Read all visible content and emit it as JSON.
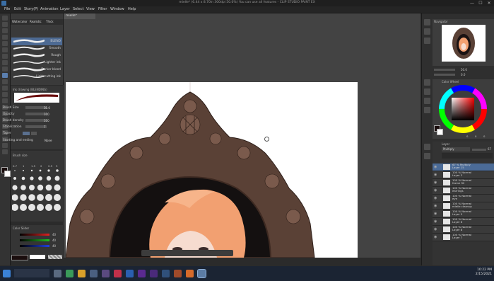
{
  "window": {
    "title": "mielle* (6.44 x 8.70in 300dpi 50.0%) You can use all features - CLIP STUDIO PAINT EX",
    "controls": [
      "—",
      "☐",
      "✕"
    ]
  },
  "menu": [
    "File",
    "Edit",
    "Story(P)",
    "Animation",
    "Layer",
    "Select",
    "View",
    "Filter",
    "Window",
    "Help"
  ],
  "canvas_tab": "mielle*",
  "subtool": {
    "tabs": [
      "Watercolor",
      "Realistic",
      "Thick"
    ],
    "strokes": [
      {
        "label": "BLEND",
        "selected": true
      },
      {
        "label": "Smooth"
      },
      {
        "label": "Rough"
      },
      {
        "label": "Lighter ink"
      },
      {
        "label": "Darker bleed"
      },
      {
        "label": "Light cutting ink"
      }
    ]
  },
  "properties": {
    "header": "Ink drawing (BLENDING)",
    "rows": [
      {
        "label": "Brush Size",
        "value": "30.0"
      },
      {
        "label": "Opacity",
        "value": "100"
      },
      {
        "label": "Brush density",
        "value": "100"
      },
      {
        "label": "Stabilization",
        "value": "7"
      },
      {
        "label": "Taper",
        "value": ""
      },
      {
        "label": "Starting and ending",
        "value": "None"
      }
    ]
  },
  "brush_size": {
    "header": "Brush size",
    "labels": [
      "0.7",
      "1",
      "1.5",
      "2",
      "2.5",
      "3",
      "4",
      "5"
    ]
  },
  "color_slider": {
    "header": "Color Slider",
    "values": [
      "40",
      "40",
      "40"
    ]
  },
  "navigator": {
    "header": "Navigator",
    "zoom": "50.0",
    "rotate": "0.0"
  },
  "color_wheel": {
    "header": "Color Wheel",
    "h": "0",
    "s": "0",
    "v": "0"
  },
  "layers": {
    "header": "Layer",
    "blend_mode": "Multiply",
    "opacity": "67",
    "items": [
      {
        "pct": "67 %",
        "mode": "Multiply",
        "name": "Layer 15"
      },
      {
        "pct": "100 %",
        "mode": "Normal",
        "name": "Layer 3"
      },
      {
        "pct": "100 %",
        "mode": "Normal",
        "name": "frame fill"
      },
      {
        "pct": "100 %",
        "mode": "Normal",
        "name": "earrings"
      },
      {
        "pct": "100 %",
        "mode": "Normal",
        "name": "eye"
      },
      {
        "pct": "100 %",
        "mode": "Normal",
        "name": "mielle cleanup"
      },
      {
        "pct": "100 %",
        "mode": "Normal",
        "name": "Layer 5"
      },
      {
        "pct": "100 %",
        "mode": "Normal",
        "name": "Layer 6"
      },
      {
        "pct": "100 %",
        "mode": "Normal",
        "name": "Layer 8"
      },
      {
        "pct": "100 %",
        "mode": "Normal",
        "name": "Layer 7"
      }
    ]
  },
  "taskbar": {
    "time": "10:22 PM",
    "date": "2/15/2021"
  },
  "colors": {
    "frame": "#5a4136",
    "hair": "#f2a071",
    "accent": "#4a7ec0"
  }
}
